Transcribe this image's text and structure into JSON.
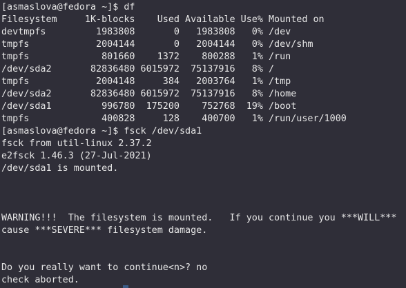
{
  "terminal": {
    "lines": [
      "[asmaslova@fedora ~]$ df",
      "Filesystem     1K-blocks    Used Available Use% Mounted on",
      "devtmpfs         1983808       0   1983808   0% /dev",
      "tmpfs            2004144       0   2004144   0% /dev/shm",
      "tmpfs             801660    1372    800288   1% /run",
      "/dev/sda2       82836480 6015972  75137916   8% /",
      "tmpfs            2004148     384   2003764   1% /tmp",
      "/dev/sda2       82836480 6015972  75137916   8% /home",
      "/dev/sda1         996780  175200    752768  19% /boot",
      "tmpfs             400828     128    400700   1% /run/user/1000",
      "[asmaslova@fedora ~]$ fsck /dev/sda1",
      "fsck from util-linux 2.37.2",
      "e2fsck 1.46.3 (27-Jul-2021)",
      "/dev/sda1 is mounted.",
      "",
      "",
      "",
      "WARNING!!!  The filesystem is mounted.   If you continue you ***WILL***",
      "cause ***SEVERE*** filesystem damage.",
      "",
      "",
      "Do you really want to continue<n>? no",
      "check aborted."
    ]
  }
}
